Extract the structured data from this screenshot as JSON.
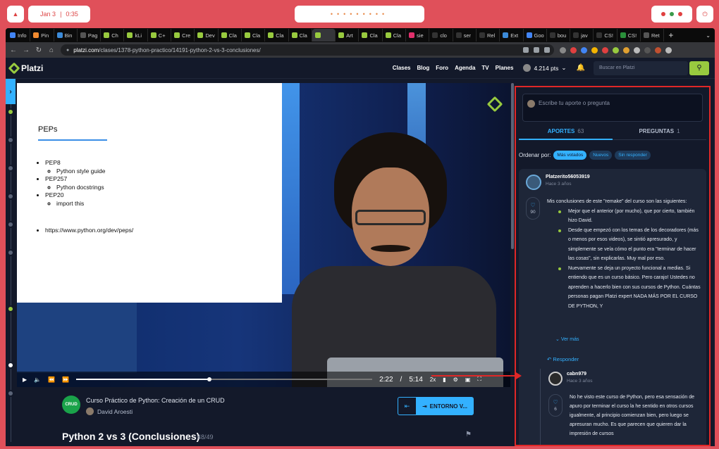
{
  "os": {
    "date": "Jan 3",
    "time": "0:35"
  },
  "tabs": [
    {
      "label": "Info",
      "color": "#4285f4"
    },
    {
      "label": "Pin",
      "color": "#f28b30"
    },
    {
      "label": "Bin",
      "color": "#3c8bd9"
    },
    {
      "label": "Pag",
      "color": "#555555"
    },
    {
      "label": "Ch",
      "color": "#98ca3f"
    },
    {
      "label": "kLi",
      "color": "#98ca3f"
    },
    {
      "label": "C+",
      "color": "#98ca3f"
    },
    {
      "label": "Cre",
      "color": "#98ca3f"
    },
    {
      "label": "Dev",
      "color": "#98ca3f"
    },
    {
      "label": "Cla",
      "color": "#98ca3f"
    },
    {
      "label": "Cla",
      "color": "#98ca3f"
    },
    {
      "label": "Cla",
      "color": "#98ca3f"
    },
    {
      "label": "Cla",
      "color": "#98ca3f"
    },
    {
      "label": "",
      "color": "#98ca3f"
    },
    {
      "label": "Art",
      "color": "#98ca3f"
    },
    {
      "label": "Cla",
      "color": "#98ca3f"
    },
    {
      "label": "Cla",
      "color": "#98ca3f"
    },
    {
      "label": "sie",
      "color": "#e1306c"
    },
    {
      "label": "clo",
      "color": "#333333"
    },
    {
      "label": "ser",
      "color": "#333333"
    },
    {
      "label": "Rel",
      "color": "#333333"
    },
    {
      "label": "Ext",
      "color": "#3c8bd9"
    },
    {
      "label": "Goo",
      "color": "#4285f4"
    },
    {
      "label": "bou",
      "color": "#333333"
    },
    {
      "label": "jav",
      "color": "#333333"
    },
    {
      "label": "CS!",
      "color": "#333333"
    },
    {
      "label": "CS!",
      "color": "#2a8f3a"
    },
    {
      "label": "Ret",
      "color": "#555555"
    }
  ],
  "address": {
    "host": "platzi.com",
    "path": "/clases/1378-python-practico/14191-python-2-vs-3-conclusiones/"
  },
  "header": {
    "brand": "Platzi",
    "nav": [
      "Clases",
      "Blog",
      "Foro",
      "Agenda",
      "TV",
      "Planes"
    ],
    "points": "4.214 pts",
    "search_placeholder": "Buscar en Platzi",
    "search_icon": "search-icon"
  },
  "slide": {
    "title": "PEPs",
    "items": [
      {
        "label": "PEP8",
        "sub": "Python style guide"
      },
      {
        "label": "PEP257",
        "sub": "Python docstrings"
      },
      {
        "label": "PEP20",
        "sub": "import this"
      }
    ],
    "link": "https://www.python.org/dev/peps/"
  },
  "player": {
    "current": "2:22",
    "sep": "/",
    "duration": "5:14",
    "speed": "2x",
    "progress": 0.45
  },
  "course": {
    "badge": "CRUD",
    "title": "Curso Práctico de Python: Creación de un CRUD",
    "teacher": "David Aroesti",
    "env_label": "ENTORNO V...",
    "class_title": "Python 2 vs 3 (Conclusiones)",
    "class_count": "48/49"
  },
  "panel": {
    "ask_placeholder": "Escribe tu aporte o pregunta",
    "tab_aportes": "APORTES",
    "tab_aportes_count": "63",
    "tab_preguntas": "PREGUNTAS",
    "tab_preguntas_count": "1",
    "order_label": "Ordenar por:",
    "chips": [
      "Más votados",
      "Nuevos",
      "Sin responder"
    ],
    "comment": {
      "user": "Platzerito56053919",
      "time": "Hace 3 años",
      "likes": "90",
      "intro": "Mis conclusiones de este \"remake\" del curso son las siguientes:",
      "bullets": [
        "Mejor que el anterior (por mucho), que por cierto, también hizo David.",
        "Desde que empezó con los temas de los decoradores (más o menos por esos videos), se sintió apresurado, y simplemente se veía cómo el punto era \"terminar de hacer las cosas\", sin explicarlas. Muy mal por eso.",
        "Nuevamente se deja un proyecto funcional a medias. Si entiendo que es un curso básico. Pero carajo! Ustedes no aprenden a hacerlo bien con sus cursos de Python. Cuántas personas pagan Platzi expert NADA MÁS POR EL CURSO DE PYTHON, Y"
      ],
      "ver_mas": "Ver más",
      "reply": "Responder"
    },
    "reply": {
      "user": "cabn979",
      "time": "Hace 3 años",
      "likes": "6",
      "text": "No he visto este curso de Python, pero esa sensación de apuro por terminar el curso la he sentido en otros cursos igualmente, al principio comienzan bien, pero luego se apresuran mucho. Es que parecen que quieren dar la impresión de cursos"
    }
  }
}
